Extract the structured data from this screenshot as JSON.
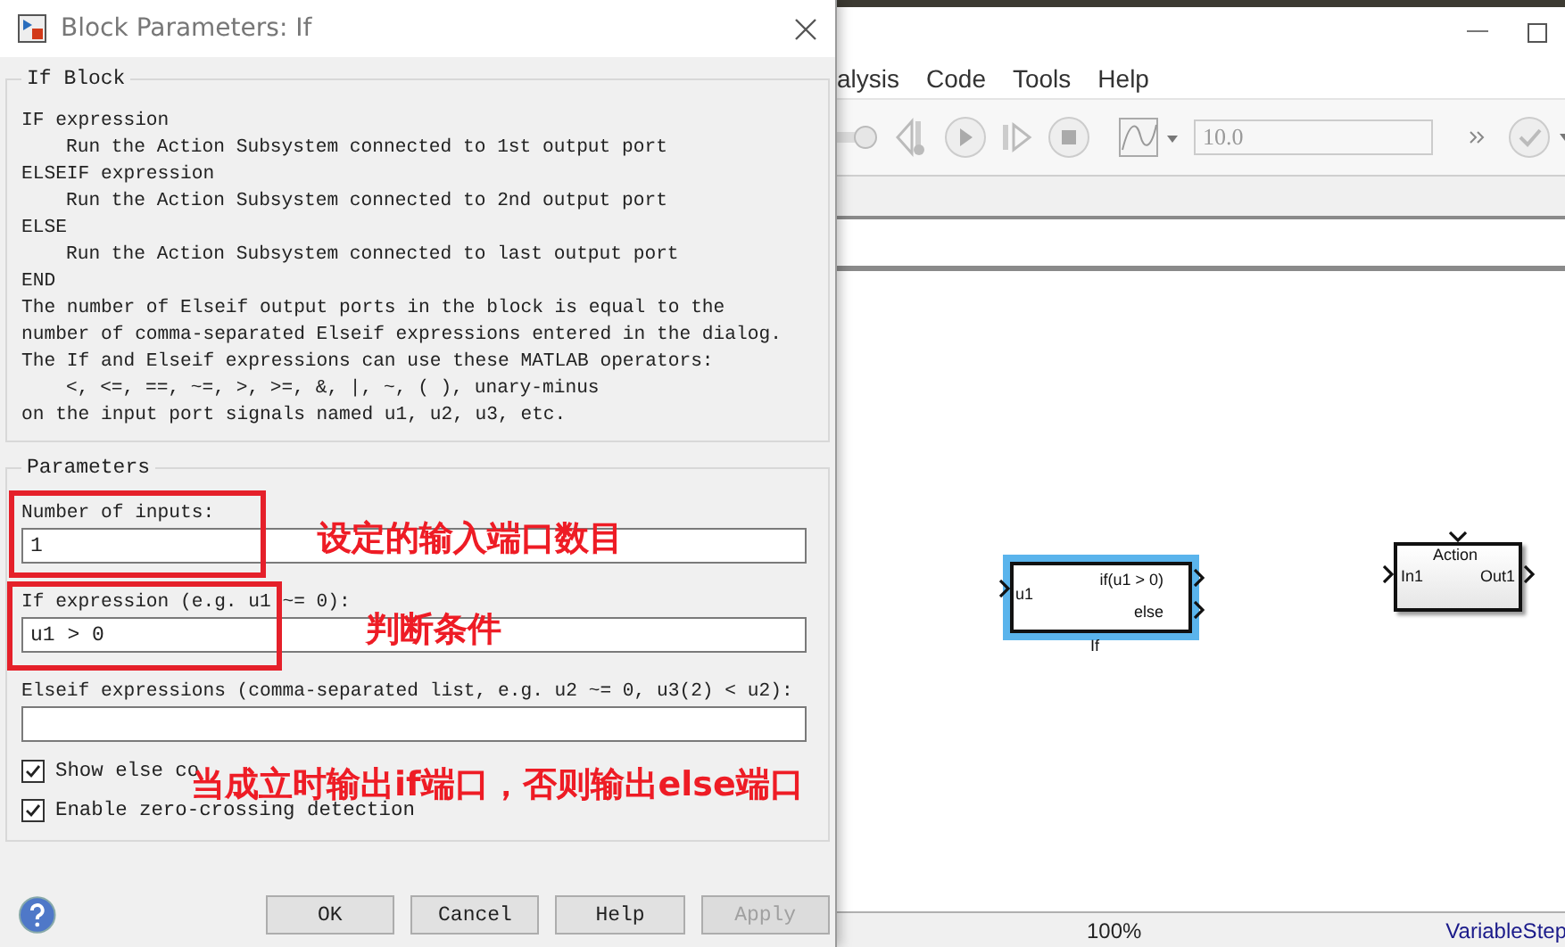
{
  "dialog": {
    "title": "Block Parameters: If",
    "description_group": {
      "title": "If Block",
      "lines": [
        {
          "text": "IF expression",
          "indented": false
        },
        {
          "text": "Run the Action Subsystem connected to 1st output port",
          "indented": true
        },
        {
          "text": "ELSEIF expression",
          "indented": false
        },
        {
          "text": "Run the Action Subsystem connected to 2nd output port",
          "indented": true
        },
        {
          "text": "ELSE",
          "indented": false
        },
        {
          "text": "Run the Action Subsystem connected to last output port",
          "indented": true
        },
        {
          "text": "END",
          "indented": false
        },
        {
          "text": "The number of Elseif output ports in the block is equal to the",
          "indented": false
        },
        {
          "text": "number of comma-separated Elseif expressions entered in the dialog.",
          "indented": false
        },
        {
          "text": "The If and Elseif expressions can use these MATLAB operators:",
          "indented": false
        },
        {
          "text": "<, <=, ==, ~=, >, >=, &, |, ~, ( ), unary-minus",
          "indented": true
        },
        {
          "text": "on the input port signals named u1, u2, u3, etc.",
          "indented": false
        }
      ]
    },
    "parameters_group": {
      "title": "Parameters",
      "fields": [
        {
          "label": "Number of inputs:",
          "value": "1"
        },
        {
          "label": "If expression (e.g. u1 ~= 0):",
          "value": "u1 > 0"
        },
        {
          "label": "Elseif expressions (comma-separated list, e.g. u2 ~= 0, u3(2) < u2):"
        }
      ],
      "checkboxes": [
        {
          "label": "Show else co",
          "checked": true
        },
        {
          "label": "Enable zero-crossing detection",
          "checked": true
        }
      ]
    },
    "buttons": [
      {
        "label": "OK",
        "disabled": false
      },
      {
        "label": "Cancel",
        "disabled": false
      },
      {
        "label": "Help",
        "disabled": false
      },
      {
        "label": "Apply",
        "disabled": true
      }
    ]
  },
  "model_window": {
    "menu": [
      "alysis",
      "Code",
      "Tools",
      "Help"
    ],
    "stop_time": "10.0",
    "blocks": [
      {
        "kind": "if",
        "label": "If",
        "inputs": [
          "u1"
        ],
        "outputs": [
          "if(u1 > 0)",
          "else"
        ],
        "selected": true
      },
      {
        "kind": "action",
        "header": "Action",
        "inputs": [
          "In1"
        ],
        "outputs": [
          "Out1"
        ],
        "selected": false
      }
    ],
    "status_bar": {
      "zoom": "100%",
      "solver": "VariableStep"
    }
  },
  "annotations": [
    "设定的输入端口数目",
    "判断条件",
    "当成立时输出if端口，否则输出else端口"
  ]
}
